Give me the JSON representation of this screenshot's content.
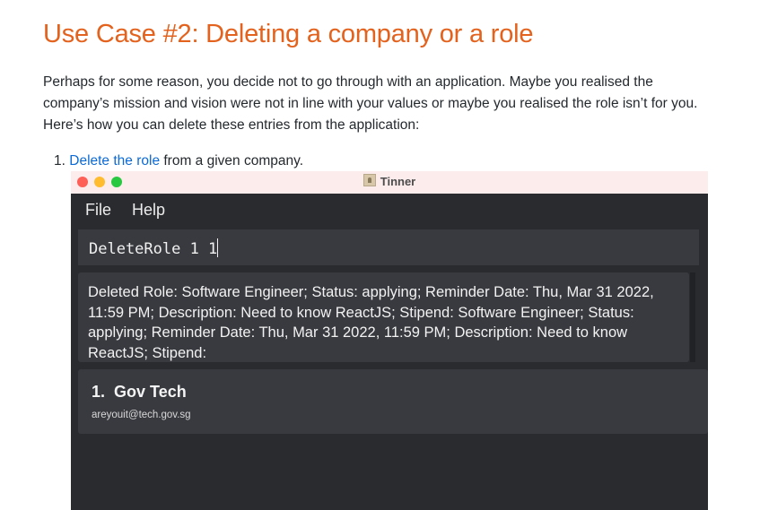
{
  "heading": "Use Case #2: Deleting a company or a role",
  "paragraph": "Perhaps for some reason, you decide not to go through with an application. Maybe you realised the company’s mission and vision were not in line with your values or maybe you realised the role isn’t for you. Here’s how you can delete these entries from the application:",
  "steps": [
    {
      "number": "1.",
      "link_text": "Delete the role",
      "rest": " from a given company."
    }
  ],
  "app": {
    "window_title": "Tinner",
    "menu": [
      "File",
      "Help"
    ],
    "command_input": "DeleteRole 1 1",
    "result_text": "Deleted Role: Software Engineer; Status: applying; Reminder Date: Thu, Mar 31 2022, 11:59 PM; Description: Need to know ReactJS; Stipend:  Software Engineer; Status: applying; Reminder Date: Thu, Mar 31 2022, 11:59 PM; Description: Need to know ReactJS; Stipend:",
    "companies": [
      {
        "index": "1.",
        "name": "Gov Tech",
        "email": "areyouit@tech.gov.sg"
      }
    ]
  },
  "colors": {
    "heading": "#e3621d",
    "link": "#0b6ad6",
    "app_background": "#2a2b2f",
    "panel": "#393a3f"
  }
}
